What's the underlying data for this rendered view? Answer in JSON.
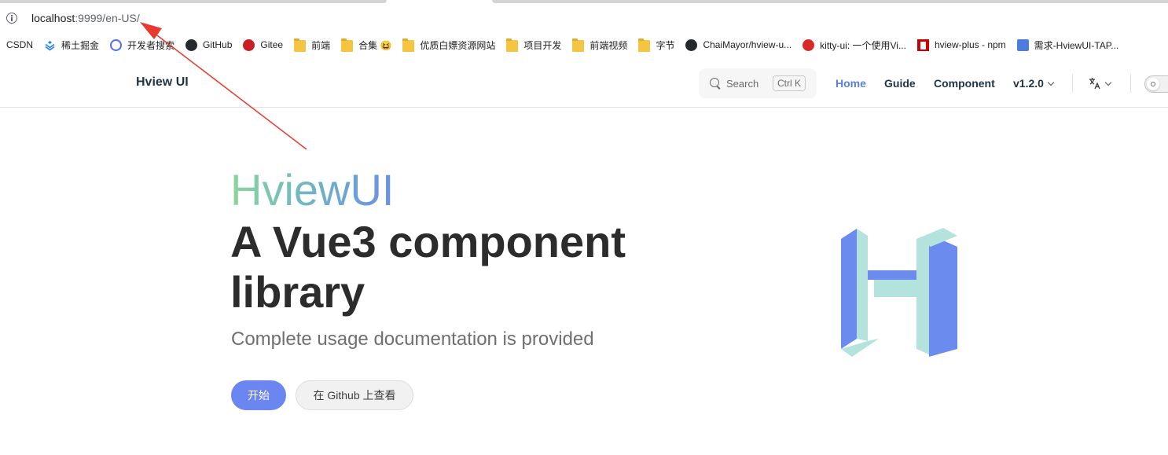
{
  "browser": {
    "url_host": "localhost",
    "url_rest": ":9999/en-US/"
  },
  "bookmarks": [
    {
      "label": "CSDN",
      "icon": "none"
    },
    {
      "label": "稀土掘金",
      "icon": "juejin-icon"
    },
    {
      "label": "开发者搜索",
      "icon": "search-icon"
    },
    {
      "label": "GitHub",
      "icon": "github-icon"
    },
    {
      "label": "Gitee",
      "icon": "gitee-icon"
    },
    {
      "label": "前端",
      "icon": "folder-icon"
    },
    {
      "label": "合集 😆",
      "icon": "folder-icon"
    },
    {
      "label": "优质白嫖资源网站",
      "icon": "folder-icon"
    },
    {
      "label": "项目开发",
      "icon": "folder-icon"
    },
    {
      "label": "前端视频",
      "icon": "folder-icon"
    },
    {
      "label": "字节",
      "icon": "folder-icon"
    },
    {
      "label": "ChaiMayor/hview-u...",
      "icon": "github-icon"
    },
    {
      "label": "kitty-ui: 一个使用Vi...",
      "icon": "kitty-icon"
    },
    {
      "label": "hview-plus - npm",
      "icon": "npm-icon"
    },
    {
      "label": "需求-HviewUI-TAP...",
      "icon": "tapd-icon"
    }
  ],
  "header": {
    "brand": "Hview UI",
    "search_label": "Search",
    "search_shortcut": "Ctrl K",
    "nav": {
      "home": "Home",
      "guide": "Guide",
      "component": "Component",
      "version": "v1.2.0"
    },
    "lang_icon": "translate-icon",
    "theme_icon": "sun-icon"
  },
  "hero": {
    "name": "HviewUI",
    "text": "A Vue3 component library",
    "tagline": "Complete usage documentation is provided",
    "primary_action": "开始",
    "secondary_action": "在 Github 上查看"
  },
  "colors": {
    "accent": "#5b7de8",
    "primary_button": "#6b86f0",
    "logo_blue": "#6b8bee",
    "logo_mint": "#b4e3dd",
    "annotation_arrow": "#e8382f"
  }
}
